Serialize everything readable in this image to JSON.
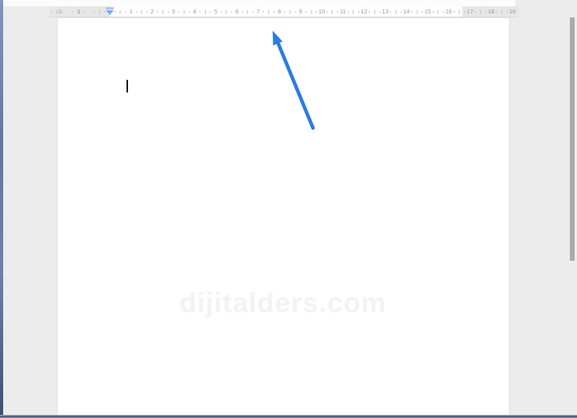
{
  "window": {
    "background_color": "#ececec",
    "edge_color": "#6b83b2",
    "bottom_border_color": "#46597c"
  },
  "ruler": {
    "left_labels": [
      "2",
      "1"
    ],
    "main_labels": [
      "1",
      "2",
      "3",
      "4",
      "5",
      "6",
      "7",
      "8",
      "9",
      "10",
      "11",
      "12",
      "13",
      "14",
      "15",
      "16",
      "17",
      "18",
      "19"
    ],
    "marker_color": "#7baaf7",
    "tick_color": "#bcbcbc",
    "label_color": "#9a9a9a"
  },
  "document": {
    "page_color": "#ffffff",
    "watermark_text": "dijitalders.com"
  },
  "annotation": {
    "arrow_color": "#2b7de1"
  },
  "scrollbar": {
    "thumb_color": "#ababab"
  }
}
